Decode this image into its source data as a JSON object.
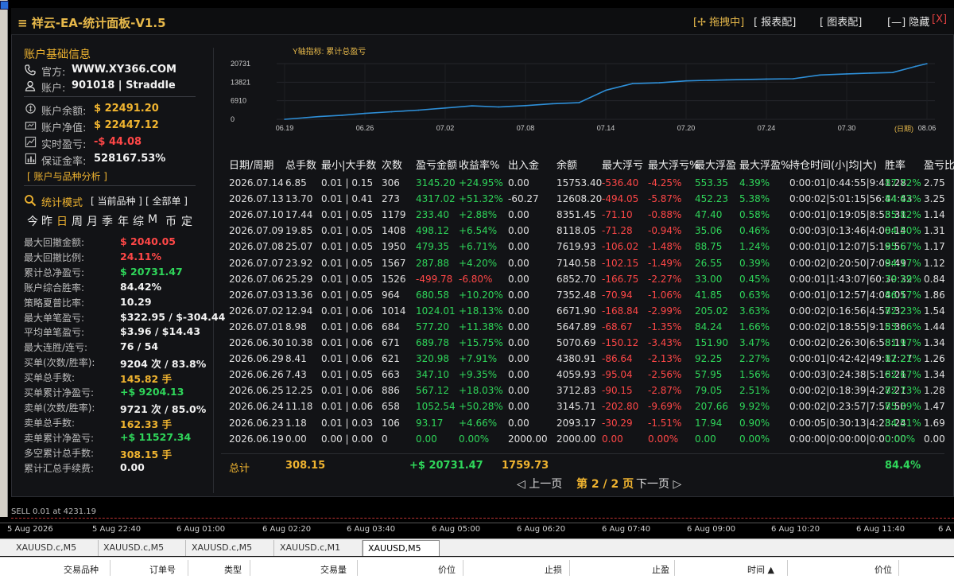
{
  "app": {
    "title": "≡ 祥云-EA-统计面板-V1.5",
    "toolbar": {
      "drag": "[✢ 拖拽中]",
      "report": "[ 报表配]",
      "chart_cfg": "[ 图表配]",
      "hide": "[—] 隐藏",
      "close": "[X]"
    }
  },
  "account": {
    "section_title": "账户基础信息",
    "site_label": "官方:",
    "site_value": "WWW.XY366.COM",
    "acct_label": "账户:",
    "acct_value": "901018 | Straddle",
    "balance_label": "账户余额:",
    "balance_value": "$ 22491.20",
    "equity_label": "账户净值:",
    "equity_value": "$ 22447.12",
    "pnl_label": "实时盈亏:",
    "pnl_value": "-$ 44.08",
    "margin_label": "保证金率:",
    "margin_value": "528167.53%",
    "analysis_link": "[ 账户与品种分析 ]"
  },
  "stats_mode": {
    "label": "统计模式",
    "current": "[ 当前品种 ]",
    "all": "[ 全部单 ]",
    "periods": [
      "今",
      "昨",
      "日",
      "周",
      "月",
      "季",
      "年",
      "综",
      "M",
      "币",
      "定"
    ],
    "active_period": "日"
  },
  "stats": [
    {
      "label": "最大回撤金额:",
      "value": "$ 2040.05",
      "color": "#ff4747"
    },
    {
      "label": "最大回撤比例:",
      "value": "24.11%",
      "color": "#ff4747"
    },
    {
      "label": "累计总净盈亏:",
      "value": "$ 20731.47",
      "color": "#2fd65a"
    },
    {
      "label": "账户综合胜率:",
      "value": "84.42%",
      "color": "#f2f2f2"
    },
    {
      "label": "策略夏普比率:",
      "value": "10.29",
      "color": "#f2f2f2"
    },
    {
      "label": "最大单笔盈亏:",
      "value": "$322.95 / $-304.44",
      "color": "#f2f2f2"
    },
    {
      "label": "平均单笔盈亏:",
      "value": "$3.96 / $14.43",
      "color": "#f2f2f2"
    },
    {
      "label": "最大连胜/连亏:",
      "value": "76 / 54",
      "color": "#f2f2f2"
    },
    {
      "label": "买单(次数/胜率):",
      "value": "9204 次 / 83.8%",
      "color": "#f2f2f2"
    },
    {
      "label": "买单总手数:",
      "value": "145.82 手",
      "color": "#f0b430"
    },
    {
      "label": "买单累计净盈亏:",
      "value": "+$ 9204.13",
      "color": "#2fd65a"
    },
    {
      "label": "卖单(次数/胜率):",
      "value": "9721 次 / 85.0%",
      "color": "#f2f2f2"
    },
    {
      "label": "卖单总手数:",
      "value": "162.33 手",
      "color": "#f0b430"
    },
    {
      "label": "卖单累计净盈亏:",
      "value": "+$ 11527.34",
      "color": "#2fd65a"
    },
    {
      "label": "多空累计总手数:",
      "value": "308.15 手",
      "color": "#f0b430"
    },
    {
      "label": "累计汇总手续费:",
      "value": "0.00",
      "color": "#f2f2f2"
    }
  ],
  "chart_data": {
    "type": "line",
    "title": "Y轴指标: 累计总盈亏",
    "xlabel": "(日期)",
    "x_ticks": [
      "06.19",
      "06.26",
      "07.02",
      "07.08",
      "07.14",
      "07.20",
      "07.24",
      "07.30",
      "08.06"
    ],
    "y_ticks": [
      0,
      6910,
      13821,
      20731
    ],
    "ylim": [
      0,
      20731
    ],
    "x": [
      "06.19",
      "06.22",
      "06.24",
      "06.26",
      "06.28",
      "06.30",
      "07.02",
      "07.04",
      "07.06",
      "07.08",
      "07.10",
      "07.12",
      "07.14",
      "07.16",
      "07.18",
      "07.20",
      "07.22",
      "07.24",
      "07.26",
      "07.28",
      "07.30",
      "08.01",
      "08.03",
      "08.05",
      "08.06"
    ],
    "values": [
      0,
      1000,
      1500,
      2200,
      2800,
      3400,
      4200,
      5000,
      4600,
      5100,
      5800,
      6200,
      10800,
      13300,
      13600,
      14300,
      14700,
      15000,
      15100,
      16500,
      16900,
      17200,
      17400,
      19700,
      20731
    ],
    "grid": true,
    "line_color": "#2e8fd8"
  },
  "table": {
    "headers": [
      "日期/周期",
      "总手数",
      "最小|大手数",
      "次数",
      "盈亏金额",
      "收益率%",
      "出入金",
      "余额",
      "最大浮亏",
      "最大浮亏%",
      "最大浮盈",
      "最大浮盈%",
      "持仓时间(小|均|大)",
      "胜率",
      "盈亏比"
    ],
    "rows": [
      [
        "2026.07.14",
        "6.85",
        "0.01 | 0.15",
        "306",
        "3145.20",
        "+24.95%",
        "0.00",
        "15753.40",
        "-536.40",
        "-4.25%",
        "553.35",
        "4.39%",
        "0:00:01|0:44:55|9:41:28",
        "87.72%",
        "2.75"
      ],
      [
        "2026.07.13",
        "13.70",
        "0.01 | 0.41",
        "273",
        "4317.02",
        "+51.32%",
        "-60.27",
        "12608.20",
        "-494.05",
        "-5.87%",
        "452.23",
        "5.38%",
        "0:00:02|5:01:15|56:44:43",
        "84.62%",
        "3.25"
      ],
      [
        "2026.07.10",
        "17.44",
        "0.01 | 0.05",
        "1179",
        "233.40",
        "+2.88%",
        "0.00",
        "8351.45",
        "-71.10",
        "-0.88%",
        "47.40",
        "0.58%",
        "0:00:01|0:19:05|8:53:31",
        "85.82%",
        "1.14"
      ],
      [
        "2026.07.09",
        "19.85",
        "0.01 | 0.05",
        "1408",
        "498.12",
        "+6.54%",
        "0.00",
        "8118.05",
        "-71.28",
        "-0.94%",
        "35.06",
        "0.46%",
        "0:00:03|0:13:46|4:00:14",
        "84.50%",
        "1.31"
      ],
      [
        "2026.07.08",
        "25.07",
        "0.01 | 0.05",
        "1950",
        "479.35",
        "+6.71%",
        "0.00",
        "7619.93",
        "-106.02",
        "-1.48%",
        "88.75",
        "1.24%",
        "0:00:01|0:12:07|5:19:56",
        "85.67%",
        "1.17"
      ],
      [
        "2026.07.07",
        "23.92",
        "0.01 | 0.05",
        "1567",
        "287.88",
        "+4.20%",
        "0.00",
        "7140.58",
        "-102.15",
        "-1.49%",
        "26.55",
        "0.39%",
        "0:00:02|0:20:50|7:09:49",
        "84.17%",
        "1.12"
      ],
      [
        "2026.07.06",
        "25.29",
        "0.01 | 0.05",
        "1526",
        "-499.78",
        "-6.80%",
        "0.00",
        "6852.70",
        "-166.75",
        "-2.27%",
        "33.00",
        "0.45%",
        "0:00:01|1:43:07|60:30:32",
        "79.29%",
        "0.84"
      ],
      [
        "2026.07.03",
        "13.36",
        "0.01 | 0.05",
        "964",
        "680.58",
        "+10.20%",
        "0.00",
        "7352.48",
        "-70.94",
        "-1.06%",
        "41.85",
        "0.63%",
        "0:00:01|0:12:57|4:04:05",
        "86.17%",
        "1.86"
      ],
      [
        "2026.07.02",
        "12.94",
        "0.01 | 0.06",
        "1014",
        "1024.01",
        "+18.13%",
        "0.00",
        "6671.90",
        "-168.84",
        "-2.99%",
        "205.02",
        "3.63%",
        "0:00:02|0:16:56|4:57:32",
        "82.23%",
        "1.54"
      ],
      [
        "2026.07.01",
        "8.98",
        "0.01 | 0.06",
        "684",
        "577.20",
        "+11.38%",
        "0.00",
        "5647.89",
        "-68.67",
        "-1.35%",
        "84.24",
        "1.66%",
        "0:00:02|0:18:55|9:15:36",
        "83.06%",
        "1.44"
      ],
      [
        "2026.06.30",
        "10.38",
        "0.01 | 0.06",
        "671",
        "689.78",
        "+15.75%",
        "0.00",
        "5070.69",
        "-150.12",
        "-3.43%",
        "151.90",
        "3.47%",
        "0:00:02|0:26:30|6:58:11",
        "81.97%",
        "1.34"
      ],
      [
        "2026.06.29",
        "8.41",
        "0.01 | 0.06",
        "621",
        "320.98",
        "+7.91%",
        "0.00",
        "4380.91",
        "-86.64",
        "-2.13%",
        "92.25",
        "2.27%",
        "0:00:01|0:42:42|49:17:27",
        "82.21%",
        "1.26"
      ],
      [
        "2026.06.26",
        "7.43",
        "0.01 | 0.05",
        "663",
        "347.10",
        "+9.35%",
        "0.00",
        "4059.93",
        "-95.04",
        "-2.56%",
        "57.95",
        "1.56%",
        "0:00:03|0:24:38|5:16:21",
        "82.67%",
        "1.34"
      ],
      [
        "2026.06.25",
        "12.25",
        "0.01 | 0.06",
        "886",
        "567.12",
        "+18.03%",
        "0.00",
        "3712.83",
        "-90.15",
        "-2.87%",
        "79.05",
        "2.51%",
        "0:00:02|0:18:39|4:27:21",
        "82.73%",
        "1.28"
      ],
      [
        "2026.06.24",
        "11.18",
        "0.01 | 0.06",
        "658",
        "1052.54",
        "+50.28%",
        "0.00",
        "3145.71",
        "-202.80",
        "-9.69%",
        "207.66",
        "9.92%",
        "0:00:02|0:23:57|7:57:50",
        "85.39%",
        "1.47"
      ],
      [
        "2026.06.23",
        "1.18",
        "0.01 | 0.03",
        "106",
        "93.17",
        "+4.66%",
        "0.00",
        "2093.17",
        "-30.29",
        "-1.51%",
        "17.94",
        "0.90%",
        "0:00:05|0:30:13|4:23:24",
        "84.51%",
        "1.69"
      ],
      [
        "2026.06.19",
        "0.00",
        "0.00 | 0.00",
        "0",
        "0.00",
        "0.00%",
        "2000.00",
        "2000.00",
        "0.00",
        "0.00%",
        "0.00",
        "0.00%",
        "0:00:00|0:00:00|0:00:00",
        "0.00%",
        "0.00"
      ]
    ],
    "total": {
      "label": "总计",
      "lots": "308.15",
      "pnl": "+$ 20731.47",
      "deposit": "1759.73",
      "winrate": "84.4%"
    },
    "pager": {
      "prev": "◁ 上一页",
      "page": "第 2 / 2 页",
      "next": "下一页 ▷"
    }
  },
  "chart_bottom": {
    "sell_text": "SELL 0.01 at 4231.19",
    "time_labels": [
      "5 Aug 2026",
      "5 Aug 22:40",
      "6 Aug 01:00",
      "6 Aug 02:20",
      "6 Aug 03:40",
      "6 Aug 05:00",
      "6 Aug 06:20",
      "6 Aug 07:40",
      "6 Aug 09:00",
      "6 Aug 10:20",
      "6 Aug 11:40",
      "6 A"
    ]
  },
  "tabs": [
    "XAUUSD.c,M5",
    "XAUUSD.c,M5",
    "XAUUSD.c,M5",
    "XAUUSD.c,M1",
    "XAUUSD,M5"
  ],
  "active_tab": 4,
  "toolbox_headers": [
    "交易品种",
    "订单号",
    "类型",
    "交易量",
    "价位",
    "止损",
    "止盈",
    "时间 ▲",
    "价位"
  ]
}
